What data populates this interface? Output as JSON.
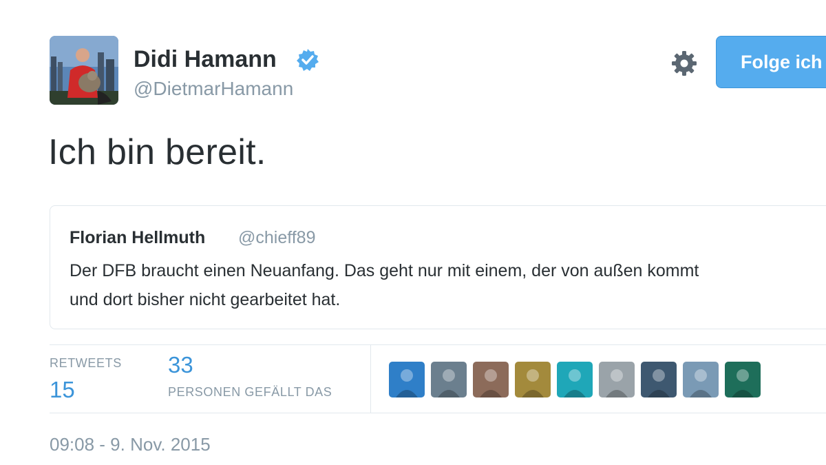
{
  "author": {
    "display_name": "Didi Hamann",
    "handle": "@DietmarHamann",
    "verified": true,
    "avatar": "profile-photo"
  },
  "actions": {
    "settings_icon": "gear-icon",
    "follow_label": "Folge ich"
  },
  "tweet": {
    "text": "Ich bin bereit."
  },
  "quoted_tweet": {
    "name": "Florian Hellmuth",
    "handle": "@chieff89",
    "text_line_1": "Der DFB braucht einen Neuanfang. Das geht nur mit einem, der von außen kommt",
    "text_line_2": "und dort bisher nicht gearbeitet hat."
  },
  "stats": {
    "retweets_label": "RETWEETS",
    "retweets_count": "15",
    "likes_count": "33",
    "likes_label": "PERSONEN GEFÄLLT DAS"
  },
  "likers": [
    {
      "name": "liker-avatar-1",
      "color": "#2f7fc8"
    },
    {
      "name": "liker-avatar-2",
      "color": "#6b7f8e"
    },
    {
      "name": "liker-avatar-3",
      "color": "#8c6b5a"
    },
    {
      "name": "liker-avatar-4",
      "color": "#a38a3c"
    },
    {
      "name": "liker-avatar-5",
      "color": "#1fa7b8"
    },
    {
      "name": "liker-avatar-6",
      "color": "#9aa3a9"
    },
    {
      "name": "liker-avatar-7",
      "color": "#3e5870"
    },
    {
      "name": "liker-avatar-8",
      "color": "#7a9ab5"
    },
    {
      "name": "liker-avatar-9",
      "color": "#1e6e5a"
    }
  ],
  "timestamp": "09:08 - 9. Nov. 2015",
  "colors": {
    "accent": "#55acee",
    "link": "#3b94d9",
    "muted": "#8899a6",
    "text": "#292f33",
    "border": "#e1e8ed"
  }
}
